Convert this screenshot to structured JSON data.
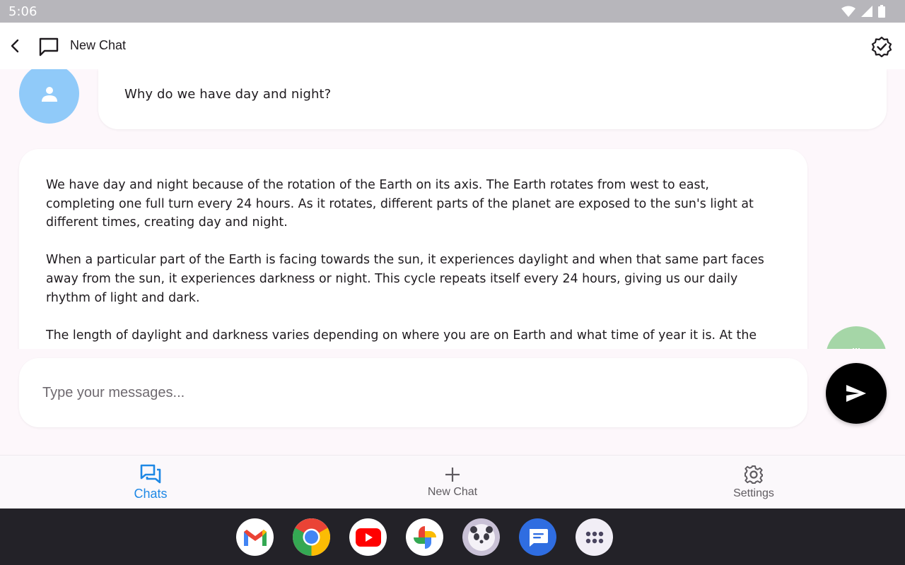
{
  "status_bar": {
    "time": "5:06"
  },
  "app_bar": {
    "title": "New Chat"
  },
  "conversation": {
    "user_message": "Why do we have day and night?",
    "bot_paragraphs": [
      "We have day and night because of the rotation of the Earth on its axis. The Earth rotates from west to east, completing one full turn every 24 hours. As it rotates, different parts of the planet are exposed to the sun's light at different times, creating day and night.",
      "When a particular part of the Earth is facing towards the sun, it experiences daylight and when that same part faces away from the sun, it experiences darkness or night. This cycle repeats itself every 24 hours, giving us our daily rhythm of light and dark.",
      "The length of daylight and darkness varies depending on where you are on Earth and what time of year it is. At the"
    ]
  },
  "composer": {
    "placeholder": "Type your messages..."
  },
  "bottom_nav": {
    "items": [
      {
        "label": "Chats"
      },
      {
        "label": "New Chat"
      },
      {
        "label": "Settings"
      }
    ]
  },
  "colors": {
    "accent": "#1e88e5",
    "avatar": "#90caf9",
    "model_chip": "#a5d6a7",
    "send_button": "#000000"
  },
  "dock_icons": [
    "gmail-icon",
    "chrome-icon",
    "youtube-icon",
    "photos-icon",
    "panda-app-icon",
    "messages-icon",
    "app-drawer-icon"
  ]
}
